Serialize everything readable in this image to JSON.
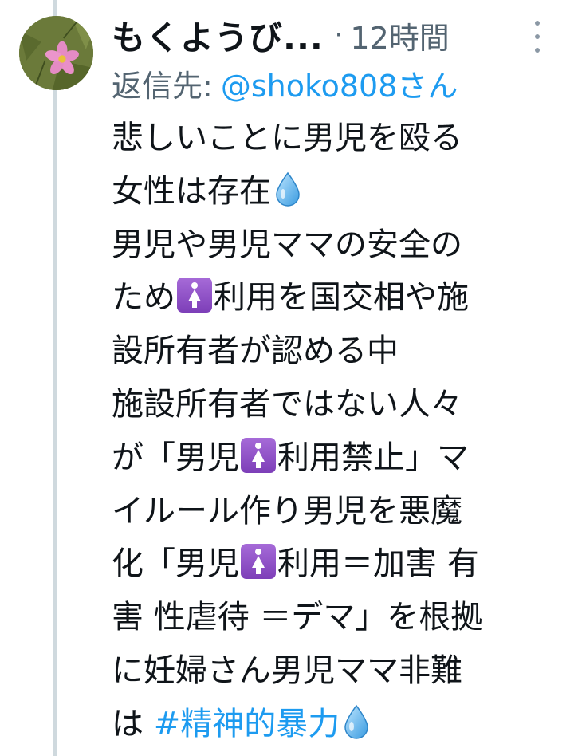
{
  "tweet": {
    "author_name": "もくようび...",
    "separator": "·",
    "time_ago": "12時間",
    "reply_label": "返信先:",
    "reply_mention": "@shoko808さん",
    "more_icon": "more-vertical-icon",
    "avatar_icon": "cosmos-flower-avatar",
    "body_lines": [
      [
        "悲しいことに男児を殴る"
      ],
      [
        "女性は存在",
        {
          "icon": "droplet-icon"
        }
      ],
      [
        "男児や男児ママの安全の"
      ],
      [
        "ため",
        {
          "icon": "womens-room-icon"
        },
        "利用を国交相や施"
      ],
      [
        "設所有者が認める中"
      ],
      [
        "施設所有者ではない人々"
      ],
      [
        "が「男児",
        {
          "icon": "womens-room-icon"
        },
        "利用禁止」マ"
      ],
      [
        "イルール作り男児を悪魔"
      ],
      [
        "化「男児",
        {
          "icon": "womens-room-icon"
        },
        "利用＝加害 有"
      ],
      [
        "害 性虐待 ＝デマ」を根拠"
      ],
      [
        "に妊婦さん男児ママ非難"
      ],
      [
        "は ",
        {
          "hashtag": "#精神的暴力"
        },
        {
          "icon": "droplet-icon"
        }
      ]
    ]
  },
  "colors": {
    "link": "#1d9bf0",
    "secondary_text": "#536471",
    "text": "#0f1419",
    "thread_line": "#cfd9de",
    "womens_icon_bg": "#9a5ccf"
  }
}
